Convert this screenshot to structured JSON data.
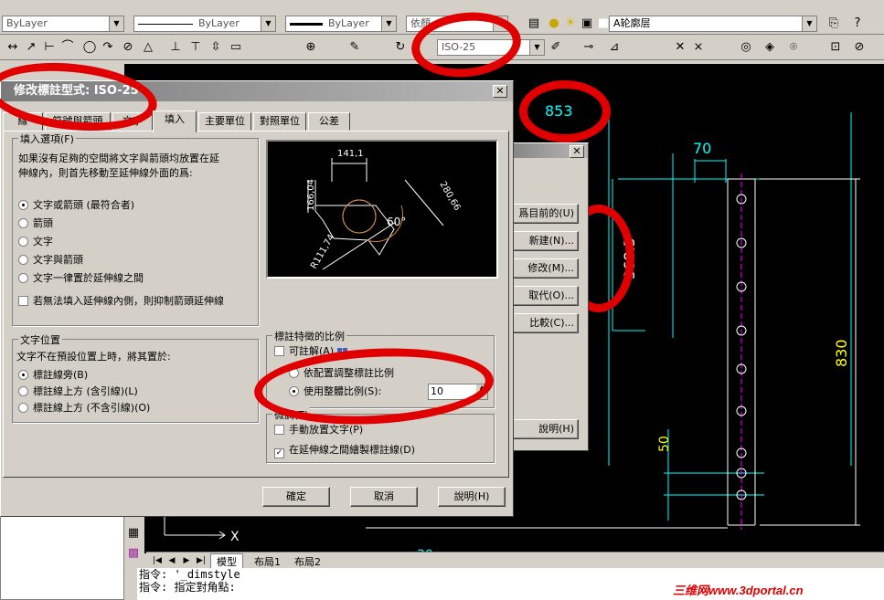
{
  "toolbar1": {
    "layer_color": "ByLayer",
    "linetype": "ByLayer",
    "lineweight": "ByLayer",
    "plotstyle": "依顏",
    "layer_name": "A轮廓层"
  },
  "toolbar2": {
    "dimstyle": "ISO-25"
  },
  "dialog": {
    "title": "修改標註型式: ISO-25",
    "tabs": [
      "線",
      "符號與箭頭",
      "文字",
      "填入",
      "主要單位",
      "對照單位",
      "公差"
    ],
    "active_tab": "填入",
    "fit_group": {
      "label": "填入選項(F)",
      "description": "如果沒有足夠的空間將文字與箭頭均放置在延伸線內，則首先移動至延伸線外面的爲:",
      "options": [
        "文字或箭頭 (最符合者)",
        "箭頭",
        "文字",
        "文字與箭頭",
        "文字一律置於延伸線之間"
      ],
      "selected": 0,
      "suppress_label": "若無法填入延伸線內側，則抑制箭頭延伸線"
    },
    "text_pos_group": {
      "label": "文字位置",
      "description": "文字不在預設位置上時，將其置於:",
      "options": [
        "標註線旁(B)",
        "標註線上方 (含引線)(L)",
        "標註線上方 (不含引線)(O)"
      ],
      "selected": 0
    },
    "preview": {
      "dim_top": "141,1",
      "dim_left": "166,04",
      "dim_diag": "280,66",
      "angle": "60°",
      "radius": "R111,74"
    },
    "scale_group": {
      "label": "標註特徵的比例",
      "annotative": "可註解(A)",
      "info_icon": "i",
      "layout_scale": "依配置調整標註比例",
      "overall_scale": "使用整體比例(S):",
      "scale_value": "10"
    },
    "fine_group": {
      "label": "微調(T)",
      "manual_text": "手動放置文字(P)",
      "draw_dimline": "在延伸線之間繪製標註線(D)"
    },
    "buttons": {
      "ok": "確定",
      "cancel": "取消",
      "help": "說明(H)"
    }
  },
  "manager": {
    "buttons": [
      "爲目前的(U)",
      "新建(N)...",
      "修改(M)...",
      "取代(O)...",
      "比較(C)..."
    ],
    "help": "說明(H)"
  },
  "drawing": {
    "dims": {
      "d853": "853",
      "d70": "70",
      "d368": "368.5",
      "d830": "830",
      "d50": "50",
      "d30": "30"
    },
    "ucs_x": "X",
    "model_tabs": [
      "模型",
      "布局1",
      "布局2"
    ]
  },
  "command": {
    "line1": "指令: '_dimstyle",
    "line2": "指令: 指定對角點:",
    "watermark": "三维网www.3dportal.cn"
  },
  "colors": {
    "accent": "#e00000",
    "cad_bg": "#000000",
    "dim_cyan": "#00ffff",
    "dim_yellow": "#ffff00"
  }
}
